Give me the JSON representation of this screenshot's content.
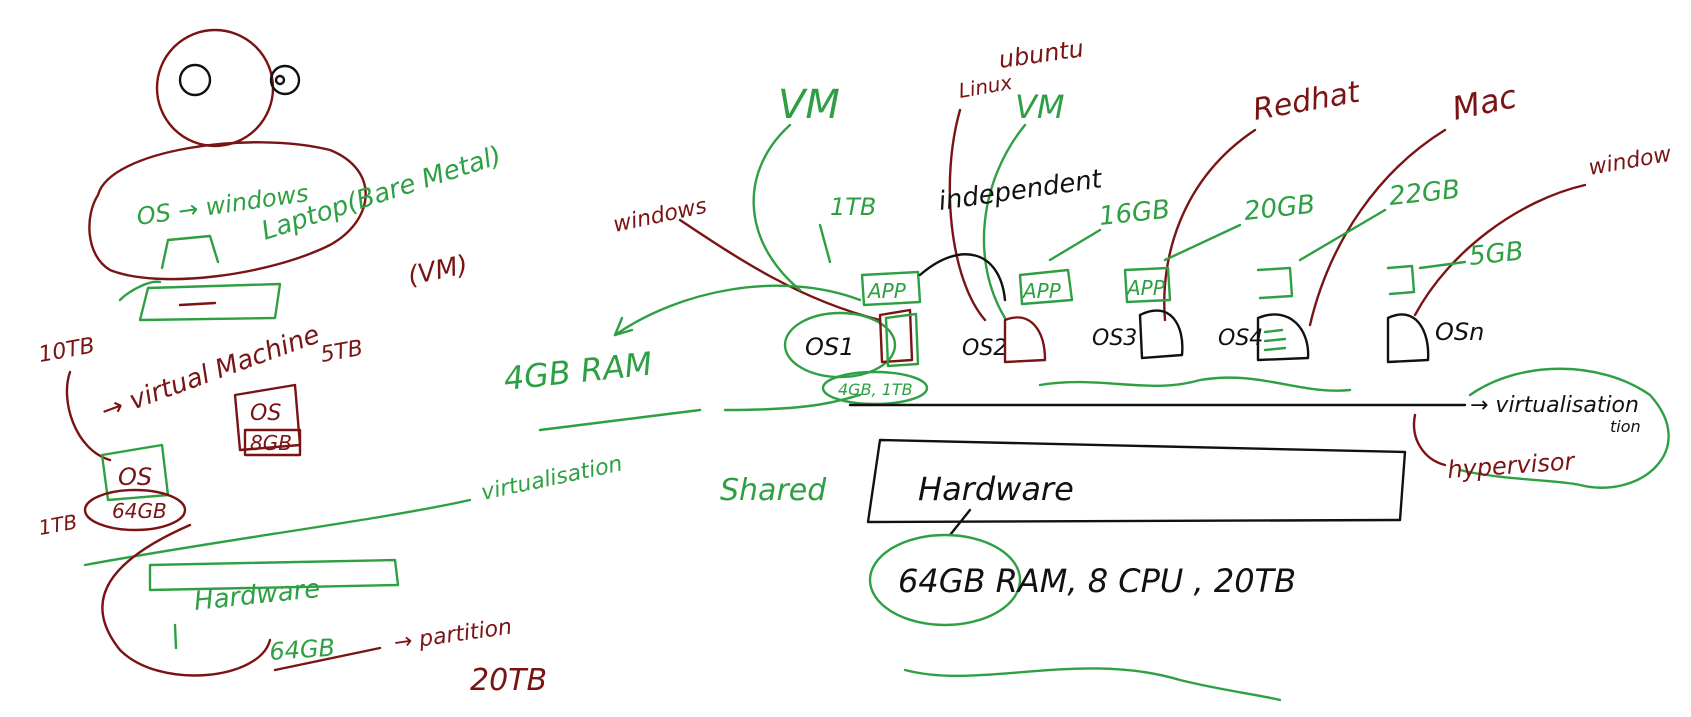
{
  "colors": {
    "ink_red": "#7a1414",
    "ink_green": "#2ea043",
    "ink_black": "#111111",
    "background": "#ffffff"
  },
  "left": {
    "os_windows": "OS → windows",
    "laptop": "Laptop(Bare Metal)",
    "virtual_machine": "→ virtual Machine",
    "vm_paren": "(VM)",
    "tb10": "10TB",
    "tb5": "5TB",
    "os_small": "OS",
    "os_box": "OS",
    "gb8": "8GB",
    "tb1": "1TB",
    "gb64": "64GB",
    "virtualisation": "virtualisation",
    "hardware": "Hardware",
    "gb64_bottom": "64GB",
    "partition": "→ partition",
    "tb20": "20TB"
  },
  "right": {
    "windows_left": "windows",
    "vm_top": "VM",
    "ubuntu": "ubuntu",
    "linux": "Linux",
    "vm_second": "VM",
    "redhat": "Redhat",
    "mac": "Mac",
    "windows_right": "window",
    "tb1": "1TB",
    "independent": "independent",
    "gb16": "16GB",
    "gb20": "20GB",
    "gb22": "22GB",
    "gb5": "5GB",
    "app1": "APP",
    "app2": "APP",
    "app3": "APP",
    "os1": "OS1",
    "os2": "OS2",
    "os3": "OS3",
    "os4": "OS4",
    "osn": "OSn",
    "ram4": "4GB RAM",
    "gb_tb_small": "4GB, 1TB",
    "virtualisation": "→ virtualisation",
    "virtualisation_2": "tion",
    "hypervisor": "hypervisor",
    "shared": "Shared",
    "hardware": "Hardware",
    "specs": "64GB RAM, 8 CPU , 20TB"
  }
}
